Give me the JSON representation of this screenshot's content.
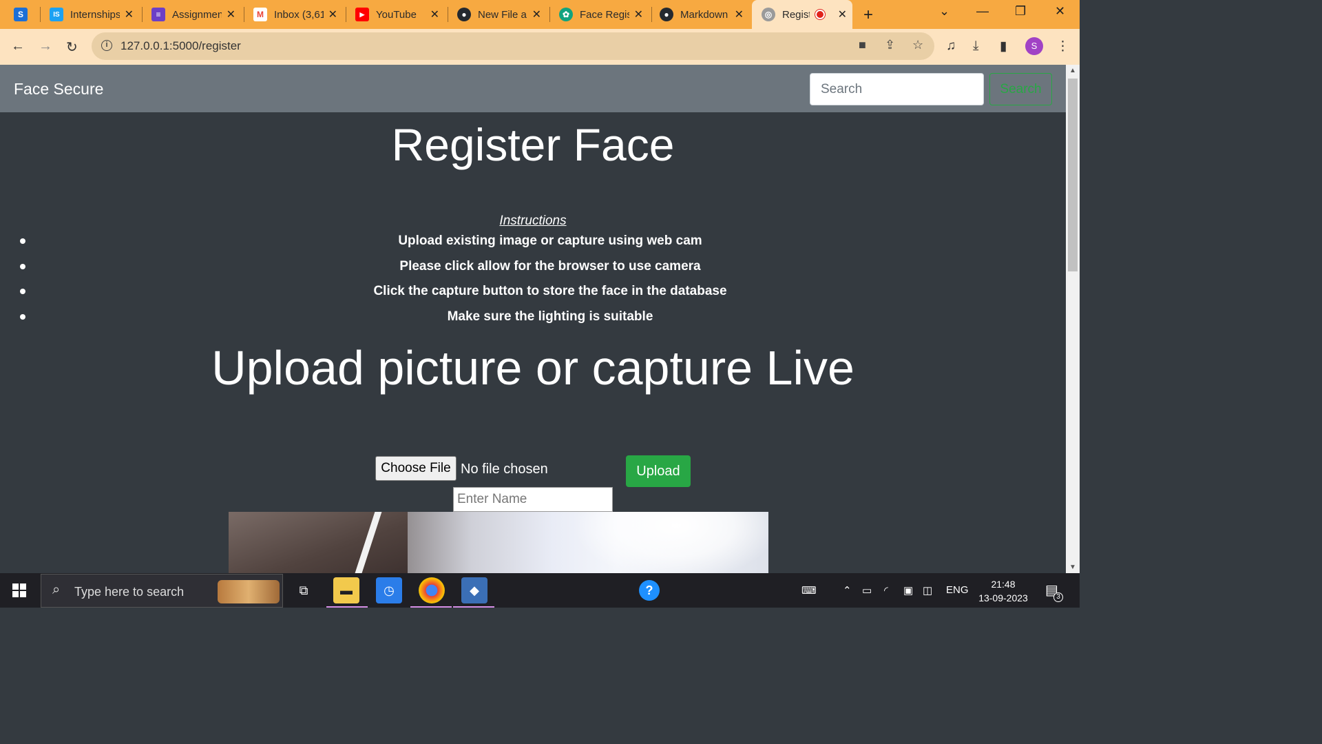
{
  "browser": {
    "tabs": [
      {
        "title": "",
        "favicon_color": "#1d6fd6",
        "favicon_letter": "S"
      },
      {
        "title": "Internships",
        "favicon_color": "#1da1f2",
        "favicon_letter": "IS"
      },
      {
        "title": "Assignment",
        "favicon_color": "#6c3fc7",
        "favicon_letter": "≡"
      },
      {
        "title": "Inbox (3,61",
        "favicon_color": "#ea4335",
        "favicon_letter": "M"
      },
      {
        "title": "YouTube",
        "favicon_color": "#ff0000",
        "favicon_letter": "▶"
      },
      {
        "title": "New File a",
        "favicon_color": "#24292f",
        "favicon_letter": "●"
      },
      {
        "title": "Face Regis",
        "favicon_color": "#10a37f",
        "favicon_letter": "✿"
      },
      {
        "title": "Markdown",
        "favicon_color": "#24292f",
        "favicon_letter": "●"
      },
      {
        "title": "Regist",
        "favicon_color": "#888888",
        "favicon_letter": "◎"
      }
    ],
    "new_tab_glyph": "+",
    "window_controls": [
      "⌄",
      "—",
      "❐",
      "✕"
    ],
    "url": "127.0.0.1:5000/register",
    "nav": {
      "back": "←",
      "forward": "→",
      "reload": "↻"
    },
    "profile_letter": "S"
  },
  "navbar": {
    "brand": "Face Secure",
    "search_placeholder": "Search",
    "search_button": "Search"
  },
  "main": {
    "title": "Register Face",
    "instructions_title": "Instructions",
    "instructions": [
      "Upload existing image or capture using web cam",
      "Please click allow for the browser to use camera",
      "Click the capture button to store the face in the database",
      "Make sure the lighting is suitable"
    ],
    "upload_heading": "Upload picture or capture Live",
    "choose_file_label": "Choose File",
    "file_status": "No file chosen",
    "upload_button": "Upload",
    "name_placeholder": "Enter Name"
  },
  "taskbar": {
    "search_text": "Type here to search",
    "language": "ENG",
    "time": "21:48",
    "date": "13-09-2023",
    "notification_count": "3"
  },
  "colors": {
    "accent_green": "#28a745",
    "navbar": "#6c757d",
    "page_bg": "#343a40",
    "tabstrip": "#f7a941"
  }
}
